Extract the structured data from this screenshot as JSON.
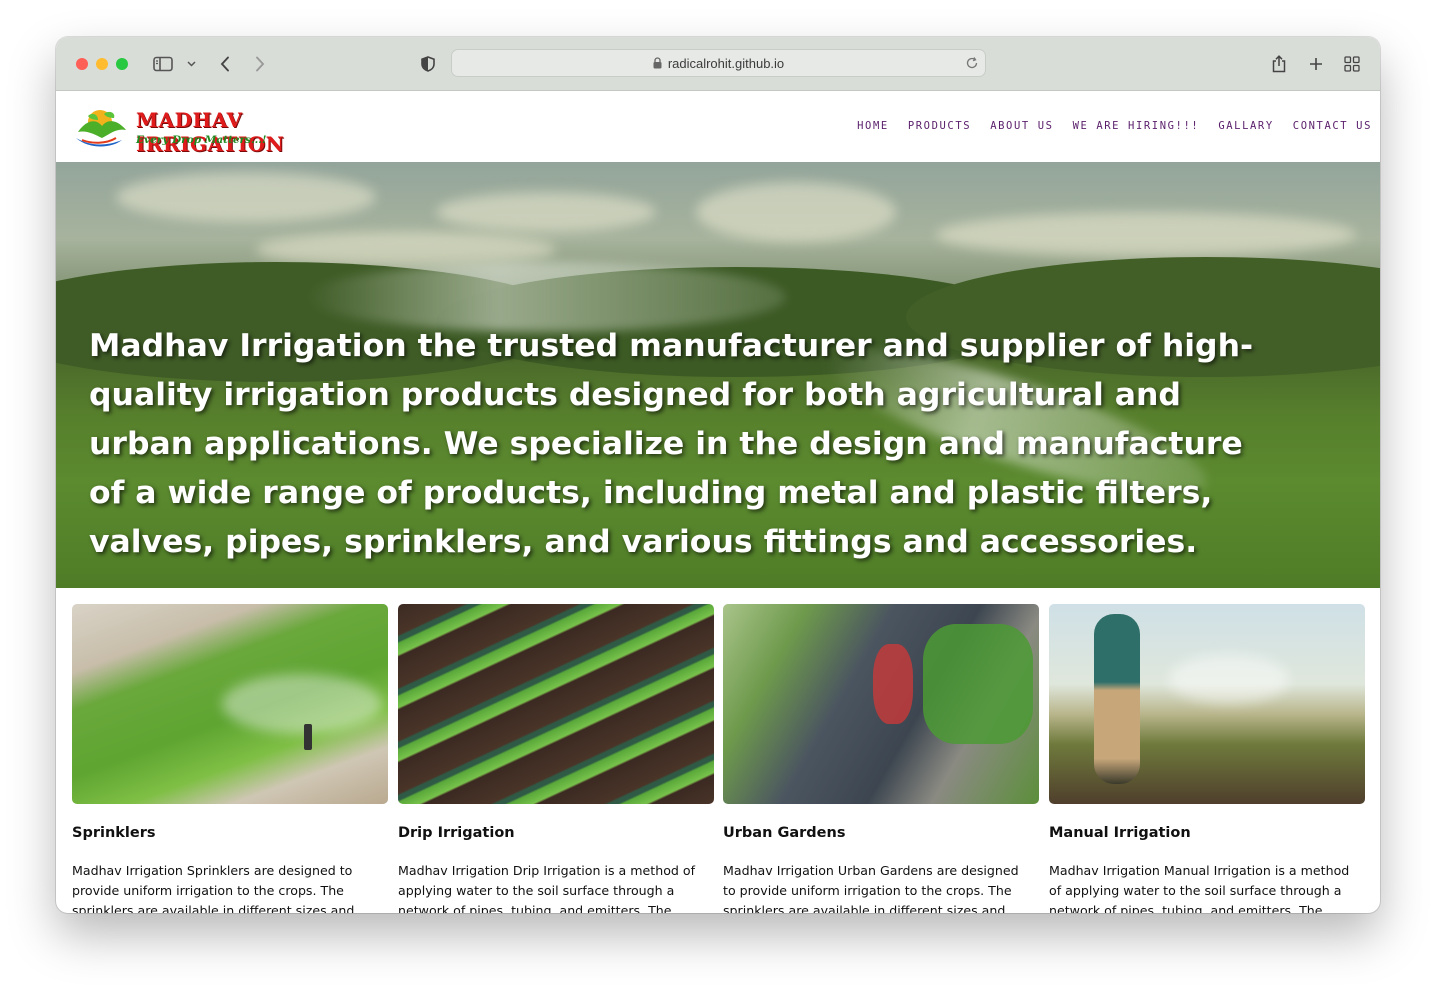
{
  "browser": {
    "url": "radicalrohit.github.io"
  },
  "site": {
    "logo_title": "MADHAV IRRIGATION",
    "logo_tagline": "Every Drop Matters...!",
    "nav": [
      "HOME",
      "PRODUCTS",
      "ABOUT US",
      "WE ARE HIRING!!!",
      "GALLARY",
      "CONTACT US"
    ],
    "nav_color": "#5a1f6b",
    "logo_color": "#e01b1b"
  },
  "hero": {
    "text": "Madhav Irrigation the trusted manufacturer and supplier of high-quality irrigation products designed for both agricultural and urban applications. We specialize in the design and manufacture of a wide range of products, including metal and plastic filters, valves, pipes, sprinklers, and various fittings and accessories."
  },
  "cards": [
    {
      "title": "Sprinklers",
      "text": "Madhav Irrigation Sprinklers are designed to provide uniform irrigation to the crops. The sprinklers are available in different sizes and"
    },
    {
      "title": "Drip Irrigation",
      "text": "Madhav Irrigation Drip Irrigation is a method of applying water to the soil surface through a network of pipes, tubing, and emitters. The water"
    },
    {
      "title": "Urban Gardens",
      "text": "Madhav Irrigation Urban Gardens are designed to provide uniform irrigation to the crops. The sprinklers are available in different sizes and"
    },
    {
      "title": "Manual Irrigation",
      "text": "Madhav Irrigation Manual Irrigation is a method of applying water to the soil surface through a network of pipes, tubing, and emitters. The water"
    }
  ]
}
